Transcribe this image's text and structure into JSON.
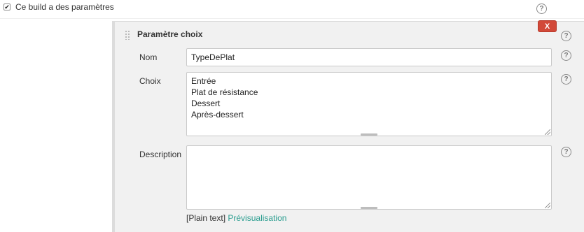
{
  "top": {
    "checkbox_checked": true,
    "checkbox_glyph": "✔",
    "checkbox_label": "Ce build a des paramètres",
    "help_glyph": "?"
  },
  "block": {
    "title": "Paramètre choix",
    "delete_label": "X",
    "help_glyph": "?"
  },
  "fields": {
    "name": {
      "label": "Nom",
      "value": "TypeDePlat",
      "help_glyph": "?"
    },
    "choices": {
      "label": "Choix",
      "lines": [
        "Entrée",
        "Plat de résistance",
        "Dessert",
        "Après-dessert"
      ],
      "help_glyph": "?"
    },
    "description": {
      "label": "Description",
      "value": "",
      "help_glyph": "?"
    }
  },
  "footer": {
    "format_text": "[Plain text]",
    "preview_link": "Prévisualisation"
  },
  "colors": {
    "delete_button": "#d24939",
    "link": "#2a9d8f",
    "panel_background": "#f1f1f1"
  },
  "icons": {
    "help": "question-circle-icon",
    "drag": "drag-handle-icon",
    "checkbox": "check-icon"
  }
}
